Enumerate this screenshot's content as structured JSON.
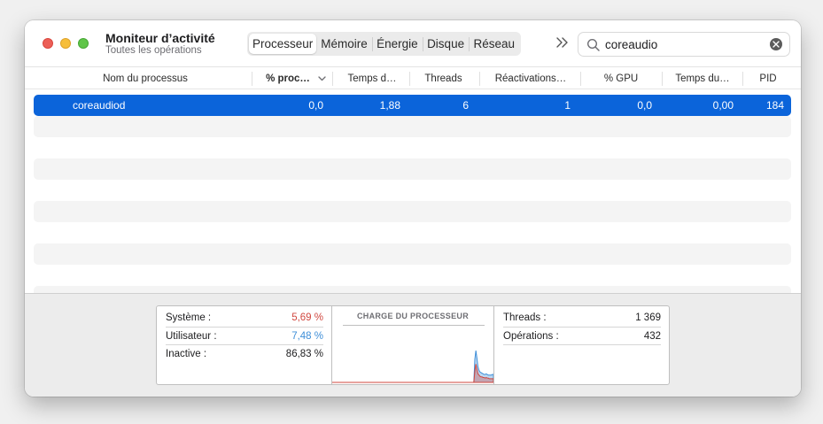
{
  "window": {
    "title": "Moniteur d’activité",
    "subtitle": "Toutes les opérations"
  },
  "tabs": [
    {
      "label": "Processeur",
      "active": true
    },
    {
      "label": "Mémoire",
      "active": false
    },
    {
      "label": "Énergie",
      "active": false
    },
    {
      "label": "Disque",
      "active": false
    },
    {
      "label": "Réseau",
      "active": false
    }
  ],
  "search": {
    "value": "coreaudio"
  },
  "columns": {
    "name": "Nom du processus",
    "cpu": "% proc…",
    "time": "Temps d…",
    "threads": "Threads",
    "wakeups": "Réactivations…",
    "gpu": "% GPU",
    "gputime": "Temps du…",
    "pid": "PID"
  },
  "process": {
    "name": "coreaudiod",
    "cpu": "0,0",
    "time": "1,88",
    "threads": "6",
    "wakeups": "1",
    "gpu": "0,0",
    "gputime": "0,00",
    "pid": "184"
  },
  "stats": {
    "system_label": "Système :",
    "system_value": "5,69 %",
    "user_label": "Utilisateur :",
    "user_value": "7,48 %",
    "idle_label": "Inactive :",
    "idle_value": "86,83 %",
    "threads_label": "Threads :",
    "threads_value": "1 369",
    "processes_label": "Opérations :",
    "processes_value": "432"
  },
  "chart": {
    "title": "CHARGE DU PROCESSEUR",
    "system_color": "#d0473f",
    "user_color": "#3f8fd8",
    "system_series": [
      0,
      0,
      0,
      0,
      0,
      0,
      0,
      0,
      0,
      0,
      0,
      0,
      0,
      0,
      0,
      0,
      0,
      0,
      0,
      0,
      0,
      0,
      0,
      0,
      0,
      0,
      0,
      0,
      0,
      0,
      0,
      0,
      0,
      0,
      0,
      0,
      0,
      0,
      0,
      0,
      0,
      0,
      0,
      0,
      0,
      0,
      0,
      0,
      0,
      0,
      0,
      0,
      0,
      0,
      0,
      0,
      0,
      0,
      0,
      0,
      0,
      0,
      0,
      0,
      0,
      0,
      0,
      0,
      0,
      0,
      0,
      0,
      0,
      0,
      0,
      0,
      0,
      0,
      0,
      0,
      0,
      0,
      0,
      0,
      0,
      0,
      0,
      0,
      0,
      0,
      0,
      0,
      0,
      0,
      0,
      0,
      0,
      0,
      0,
      0,
      0,
      0,
      0,
      0,
      0,
      0,
      0,
      0,
      0,
      0,
      0,
      0,
      0,
      0,
      0,
      0,
      0,
      0,
      0,
      0,
      0,
      0,
      0,
      0,
      0,
      0,
      0,
      0,
      0,
      0,
      0,
      0,
      0,
      0,
      0,
      0,
      0,
      0,
      18,
      30,
      22,
      14,
      12,
      10,
      9,
      9,
      8,
      8,
      7,
      8,
      7,
      7,
      6,
      6,
      6,
      6,
      6
    ],
    "user_series": [
      0,
      0,
      0,
      0,
      0,
      0,
      0,
      0,
      0,
      0,
      0,
      0,
      0,
      0,
      0,
      0,
      0,
      0,
      0,
      0,
      0,
      0,
      0,
      0,
      0,
      0,
      0,
      0,
      0,
      0,
      0,
      0,
      0,
      0,
      0,
      0,
      0,
      0,
      0,
      0,
      0,
      0,
      0,
      0,
      0,
      0,
      0,
      0,
      0,
      0,
      0,
      0,
      0,
      0,
      0,
      0,
      0,
      0,
      0,
      0,
      0,
      0,
      0,
      0,
      0,
      0,
      0,
      0,
      0,
      0,
      0,
      0,
      0,
      0,
      0,
      0,
      0,
      0,
      0,
      0,
      0,
      0,
      0,
      0,
      0,
      0,
      0,
      0,
      0,
      0,
      0,
      0,
      0,
      0,
      0,
      0,
      0,
      0,
      0,
      0,
      0,
      0,
      0,
      0,
      0,
      0,
      0,
      0,
      0,
      0,
      0,
      0,
      0,
      0,
      0,
      0,
      0,
      0,
      0,
      0,
      0,
      0,
      0,
      0,
      0,
      0,
      0,
      0,
      0,
      0,
      0,
      0,
      0,
      0,
      0,
      0,
      0,
      0,
      38,
      52,
      40,
      26,
      20,
      17,
      16,
      15,
      14,
      13,
      13,
      14,
      13,
      12,
      12,
      12,
      12,
      13,
      13
    ]
  }
}
